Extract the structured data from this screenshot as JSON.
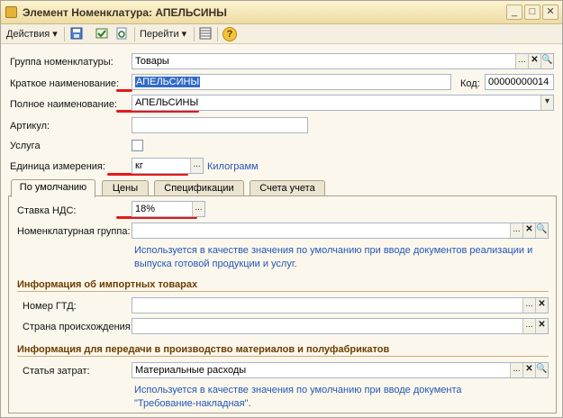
{
  "window": {
    "title": "Элемент Номенклатура: АПЕЛЬСИНЫ",
    "minimize_glyph": "_",
    "maximize_glyph": "□",
    "close_glyph": "✕"
  },
  "toolbar": {
    "actions_label": "Действия",
    "goto_label": "Перейти",
    "dropdown_glyph": "▾",
    "help_glyph": "?"
  },
  "form": {
    "group": {
      "label": "Группа номенклатуры:",
      "value": "Товары"
    },
    "short_name": {
      "label": "Краткое наименование:",
      "value": "АПЕЛЬСИНЫ"
    },
    "code": {
      "label": "Код:",
      "value": "00000000014"
    },
    "full_name": {
      "label": "Полное наименование:",
      "value": "АПЕЛЬСИНЫ"
    },
    "article": {
      "label": "Артикул:",
      "value": ""
    },
    "service": {
      "label": "Услуга",
      "checked": false
    },
    "unit": {
      "label": "Единица измерения:",
      "value": "кг",
      "link": "Килограмм"
    }
  },
  "tabs": [
    {
      "label": "По умолчанию",
      "active": true
    },
    {
      "label": "Цены",
      "active": false
    },
    {
      "label": "Спецификации",
      "active": false
    },
    {
      "label": "Счета учета",
      "active": false
    }
  ],
  "defaults_tab": {
    "vat": {
      "label": "Ставка НДС:",
      "value": "18%"
    },
    "item_group": {
      "label": "Номенклатурная группа:",
      "value": "",
      "hint_line1": "Используется в качестве значения по умолчанию при вводе документов  реализации и",
      "hint_line2": "выпуска готовой продукции и услуг."
    },
    "import_section": {
      "title": "Информация об импортных товарах",
      "gtd": {
        "label": "Номер ГТД:",
        "value": ""
      },
      "country": {
        "label": "Страна происхождения:",
        "value": ""
      }
    },
    "production_section": {
      "title": "Информация для передачи в производство материалов и полуфабрикатов",
      "cost_item": {
        "label": "Статья затрат:",
        "value": "Материальные расходы",
        "hint_line1": "Используется в качестве значения по умолчанию при вводе документа",
        "hint_line2": "\"Требование-накладная\"."
      }
    }
  },
  "field_buttons": {
    "select": "...",
    "clear": "✕",
    "open": "🔍",
    "dropdown": "▾"
  },
  "colors": {
    "selection": "#316ac5",
    "annotation_red": "#e31919",
    "hint_blue": "#2456b8",
    "section_brown": "#6b3d00"
  }
}
